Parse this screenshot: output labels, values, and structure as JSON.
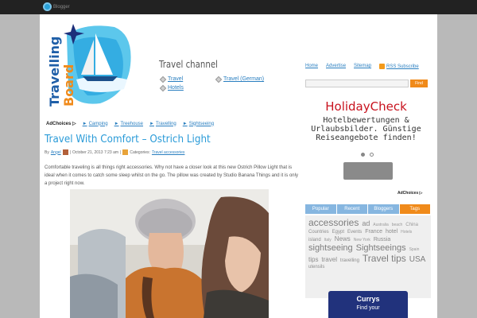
{
  "topbar": {
    "logo_text": "Blogger"
  },
  "brand": {
    "line1": "Travelling",
    "line2": "Board"
  },
  "channel": {
    "title": "Travel channel",
    "links": [
      {
        "label": "Travel"
      },
      {
        "label": "Travel (German)"
      },
      {
        "label": "Hotels"
      }
    ]
  },
  "topnav": {
    "home": "Home",
    "advertise": "Advertise",
    "sitemap": "Sitemap",
    "rss": "RSS Subscribe"
  },
  "search": {
    "placeholder": "",
    "button": "Find"
  },
  "ad": {
    "title": "HolidayCheck",
    "lines": [
      "Hotelbewertungen &",
      "Urlaubsbilder. Günstige",
      "Reiseangebote finden!"
    ]
  },
  "adchoices": {
    "label": "AdChoices"
  },
  "ad_links": [
    "Camping",
    "Treehouse",
    "Travelling",
    "Sightseeing"
  ],
  "post": {
    "title": "Travel With Comfort – Ostrich Light",
    "meta_by": "By",
    "author": "Angel",
    "date": "October 21, 2013 7:23 am",
    "categories_label": "Categories:",
    "category": "Travel accessories",
    "excerpt": "Comfortable traveling is all things right accessories. Why not have a closer look at this new Ostrich Pillow Light that is ideal when it comes to catch some sleep whilst on the go. The pillow was created by Studio Banana Things and it is only a project right now."
  },
  "tabs": [
    {
      "label": "Popular",
      "active": false
    },
    {
      "label": "Recent",
      "active": false
    },
    {
      "label": "Bloggers",
      "active": false
    },
    {
      "label": "Tags",
      "active": true
    }
  ],
  "tags": [
    {
      "label": "accessories",
      "size": 12,
      "color": "#7d7d7d"
    },
    {
      "label": "ad",
      "size": 9,
      "color": "#8c8c8c"
    },
    {
      "label": "Australia",
      "size": 5,
      "color": "#9a9a9a"
    },
    {
      "label": "beach",
      "size": 5,
      "color": "#9a9a9a"
    },
    {
      "label": "China",
      "size": 6,
      "color": "#9a9a9a"
    },
    {
      "label": "Countries",
      "size": 6,
      "color": "#8c8c8c"
    },
    {
      "label": "Egypt",
      "size": 6,
      "color": "#8c8c8c"
    },
    {
      "label": "Events",
      "size": 6,
      "color": "#8c8c8c"
    },
    {
      "label": "France",
      "size": 7,
      "color": "#8c8c8c"
    },
    {
      "label": "hotel",
      "size": 7,
      "color": "#8c8c8c"
    },
    {
      "label": "Hotels",
      "size": 5,
      "color": "#9a9a9a"
    },
    {
      "label": "island",
      "size": 6,
      "color": "#8c8c8c"
    },
    {
      "label": "Italy",
      "size": 5,
      "color": "#9a9a9a"
    },
    {
      "label": "News",
      "size": 8,
      "color": "#8c8c8c"
    },
    {
      "label": "New York",
      "size": 5,
      "color": "#9a9a9a"
    },
    {
      "label": "Russia",
      "size": 7,
      "color": "#8c8c8c"
    },
    {
      "label": "sightseeing",
      "size": 11,
      "color": "#7d7d7d"
    },
    {
      "label": "Sightseeings",
      "size": 11,
      "color": "#7d7d7d"
    },
    {
      "label": "Spain",
      "size": 5,
      "color": "#9a9a9a"
    },
    {
      "label": "tips",
      "size": 8,
      "color": "#8c8c8c"
    },
    {
      "label": "travel",
      "size": 8,
      "color": "#8c8c8c"
    },
    {
      "label": "travelling",
      "size": 6,
      "color": "#8c8c8c"
    },
    {
      "label": "Travel tips",
      "size": 12,
      "color": "#7d7d7d"
    },
    {
      "label": "USA",
      "size": 10,
      "color": "#7d7d7d"
    },
    {
      "label": "utensils",
      "size": 6,
      "color": "#8c8c8c"
    }
  ],
  "bottom_ad": {
    "brand": "Currys",
    "line": "Find your"
  }
}
